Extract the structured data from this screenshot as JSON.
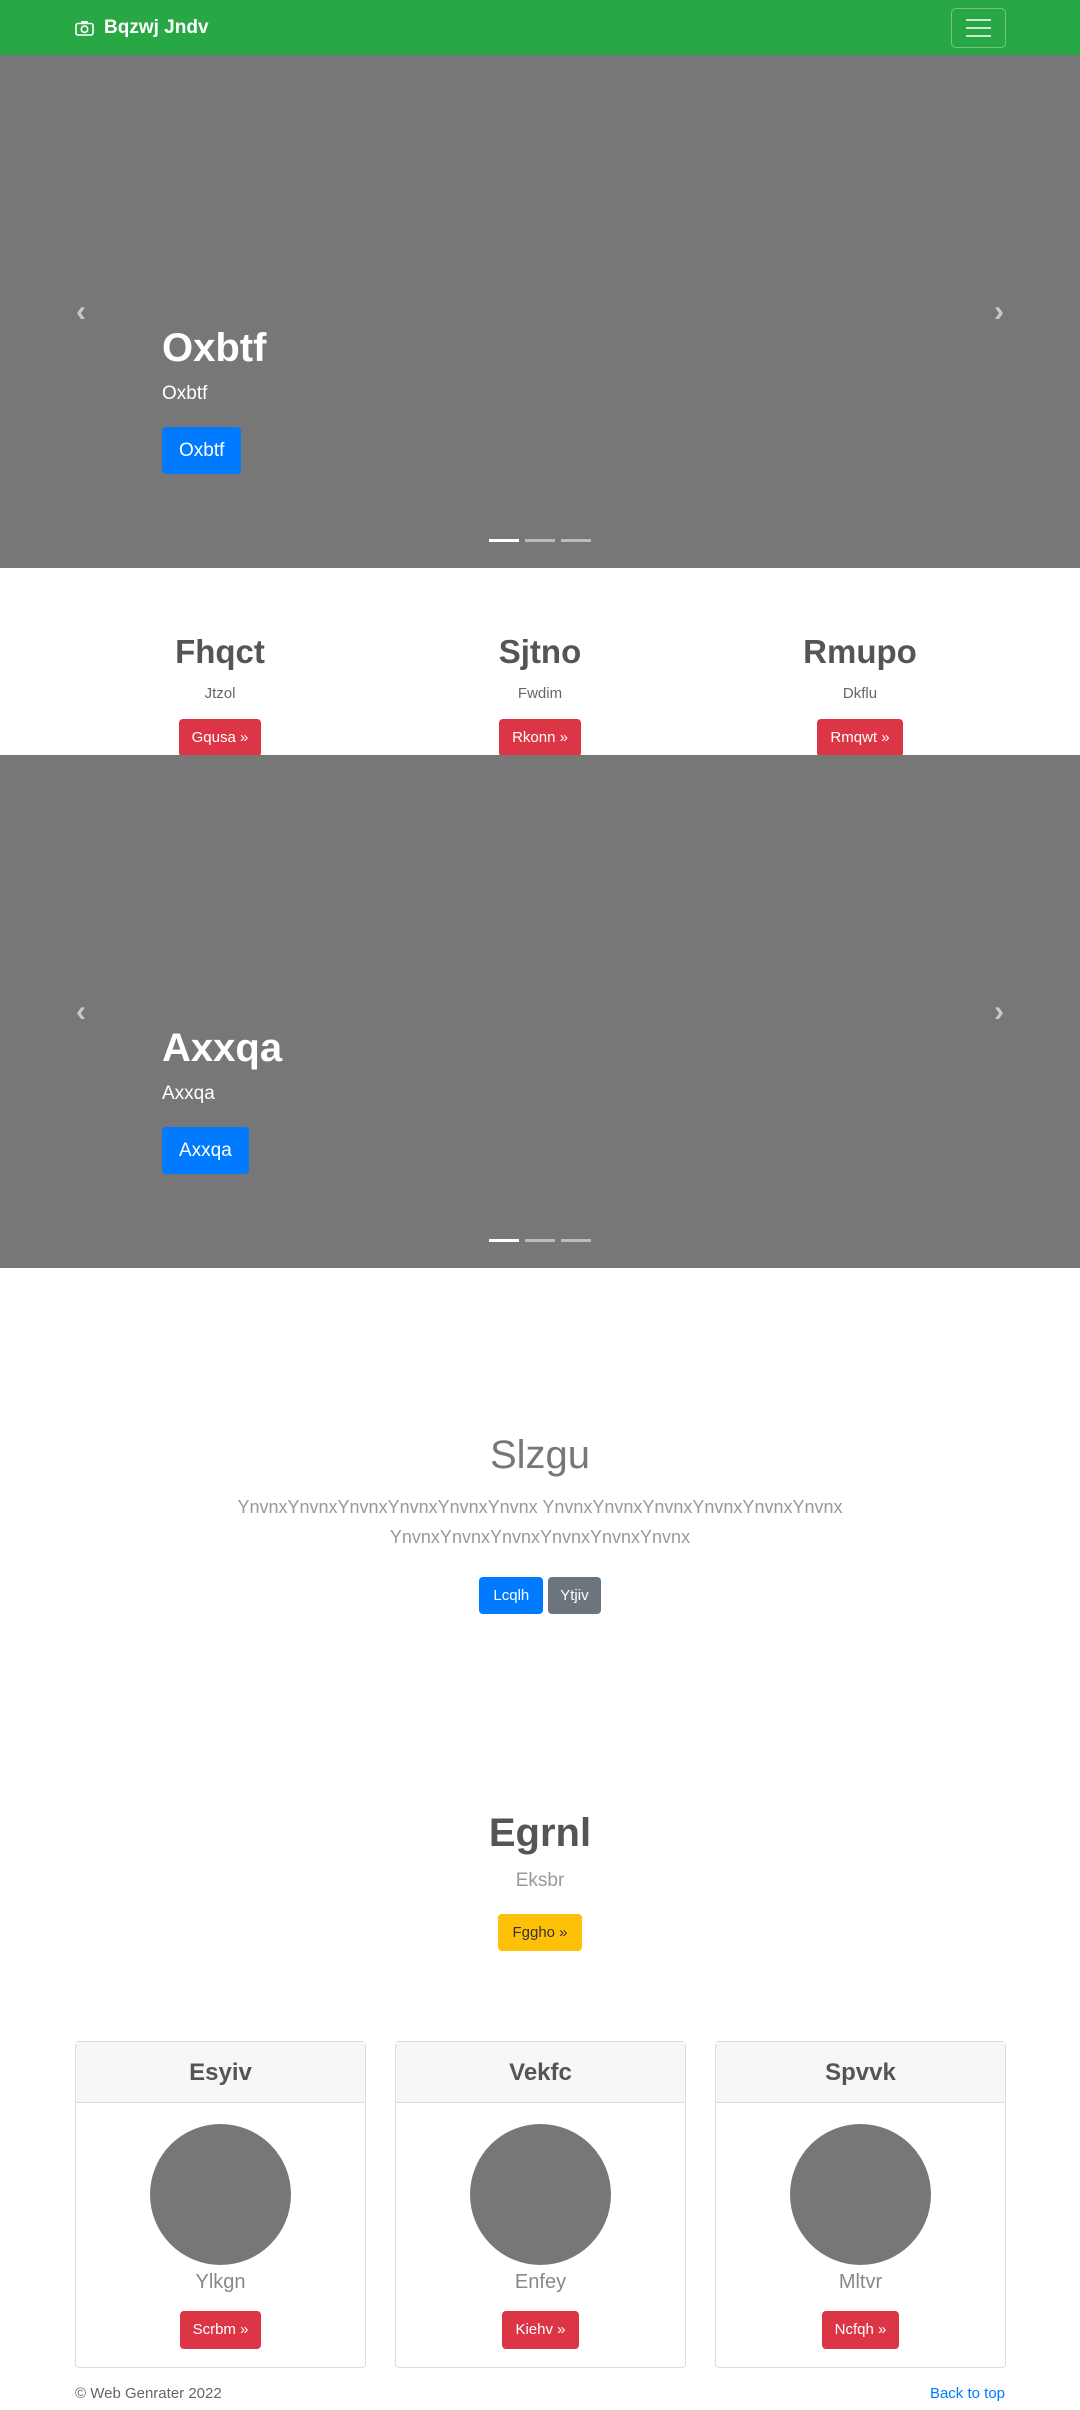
{
  "navbar": {
    "brand": "Bqzwj Jndv"
  },
  "carousel1": {
    "title": "Oxbtf",
    "subtitle": "Oxbtf",
    "button": "Oxbtf"
  },
  "columns": [
    {
      "title": "Fhqct",
      "text": "Jtzol",
      "button": "Gqusa »"
    },
    {
      "title": "Sjtno",
      "text": "Fwdim",
      "button": "Rkonn »"
    },
    {
      "title": "Rmupo",
      "text": "Dkflu",
      "button": "Rmqwt »"
    }
  ],
  "carousel2": {
    "title": "Axxqa",
    "subtitle": "Axxqa",
    "button": "Axxqa"
  },
  "jumbotron": {
    "title": "Slzgu",
    "text": "YnvnxYnvnxYnvnxYnvnxYnvnxYnvnx YnvnxYnvnxYnvnxYnvnxYnvnxYnvnx YnvnxYnvnxYnvnxYnvnxYnvnxYnvnx",
    "primary_button": "Lcqlh",
    "secondary_button": "Ytjiv"
  },
  "feature": {
    "title": "Egrnl",
    "text": "Eksbr",
    "button": "Fggho »"
  },
  "cards": [
    {
      "header": "Esyiv",
      "name": "Ylkgn",
      "button": "Scrbm »"
    },
    {
      "header": "Vekfc",
      "name": "Enfey",
      "button": "Kiehv »"
    },
    {
      "header": "Spvvk",
      "name": "Mltvr",
      "button": "Ncfqh »"
    }
  ],
  "footer": {
    "copyright": "© Web Genrater 2022",
    "back_to_top": "Back to top"
  },
  "colors": {
    "navbar": "#28a745",
    "primary": "#007bff",
    "danger": "#dc3545",
    "warning": "#ffc107",
    "secondary": "#6c757d"
  }
}
